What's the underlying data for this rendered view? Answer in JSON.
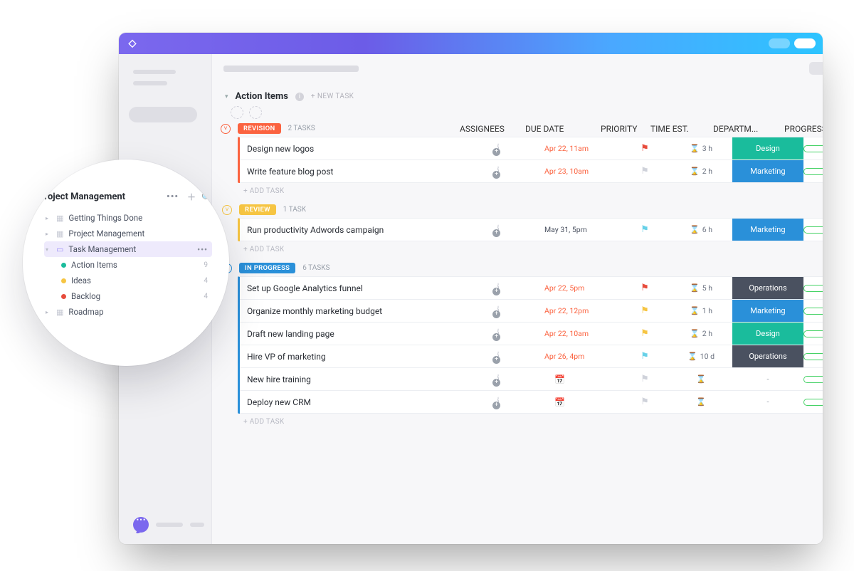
{
  "header": {
    "section_title": "Action Items",
    "new_task_label": "+ NEW TASK"
  },
  "columns": {
    "assignees": "ASSIGNEES",
    "due_date": "DUE DATE",
    "priority": "PRIORITY",
    "time_est": "TIME EST.",
    "department": "DEPARTM...",
    "progress": "PROGRESS"
  },
  "add_task": "+ ADD TASK",
  "statuses": [
    {
      "name": "REVISION",
      "color": "#fb6340",
      "count_label": "2 TASKS",
      "tasks": [
        {
          "title": "Design new logos",
          "due": "Apr 22, 11am",
          "due_color": "#fb6340",
          "flag": "flag-red",
          "time": "3 h",
          "dept": "Design",
          "dept_class": "dept-design",
          "progress": "0%"
        },
        {
          "title": "Write feature blog post",
          "due": "Apr 23, 10am",
          "due_color": "#fb6340",
          "flag": "flag-grey",
          "time": "2 h",
          "dept": "Marketing",
          "dept_class": "dept-marketing",
          "progress": "0%"
        }
      ]
    },
    {
      "name": "REVIEW",
      "color": "#f6c543",
      "count_label": "1 TASK",
      "tasks": [
        {
          "title": "Run productivity Adwords campaign",
          "due": "May 31, 5pm",
          "due_color": "#4a5160",
          "flag": "flag-cyan",
          "time": "6 h",
          "dept": "Marketing",
          "dept_class": "dept-marketing",
          "progress": "0%"
        }
      ]
    },
    {
      "name": "IN PROGRESS",
      "color": "#2a90d9",
      "count_label": "6 TASKS",
      "tasks": [
        {
          "title": "Set up Google Analytics funnel",
          "due": "Apr 22, 5pm",
          "due_color": "#fb6340",
          "flag": "flag-red",
          "time": "5 h",
          "dept": "Operations",
          "dept_class": "dept-operations",
          "progress": "0%"
        },
        {
          "title": "Organize monthly marketing budget",
          "due": "Apr 22, 12pm",
          "due_color": "#fb6340",
          "flag": "flag-yellow",
          "time": "1 h",
          "dept": "Marketing",
          "dept_class": "dept-marketing",
          "progress": "0%"
        },
        {
          "title": "Draft new landing page",
          "due": "Apr 22, 10am",
          "due_color": "#fb6340",
          "flag": "flag-yellow",
          "time": "2 h",
          "dept": "Design",
          "dept_class": "dept-design",
          "progress": "0%"
        },
        {
          "title": "Hire VP of marketing",
          "due": "Apr 26, 4pm",
          "due_color": "#fb6340",
          "flag": "flag-cyan",
          "time": "10 d",
          "dept": "Operations",
          "dept_class": "dept-operations",
          "progress": "0%"
        },
        {
          "title": "New hire training",
          "due": "",
          "due_color": "",
          "flag": "flag-grey",
          "time": "",
          "dept": "-",
          "dept_class": "dept-none",
          "progress": "0%"
        },
        {
          "title": "Deploy new CRM",
          "due": "",
          "due_color": "",
          "flag": "flag-grey",
          "time": "",
          "dept": "-",
          "dept_class": "dept-none",
          "progress": "0%"
        }
      ]
    }
  ],
  "sidebar": {
    "title": "Project Management",
    "items": [
      {
        "label": "Getting Things Done",
        "type": "folder"
      },
      {
        "label": "Project Management",
        "type": "folder"
      },
      {
        "label": "Task Management",
        "type": "folder",
        "selected": true
      },
      {
        "label": "Action Items",
        "type": "list",
        "dot": "d-teal",
        "count": "9"
      },
      {
        "label": "Ideas",
        "type": "list",
        "dot": "d-yel",
        "count": "4"
      },
      {
        "label": "Backlog",
        "type": "list",
        "dot": "d-red",
        "count": "4"
      },
      {
        "label": "Roadmap",
        "type": "folder"
      }
    ]
  }
}
